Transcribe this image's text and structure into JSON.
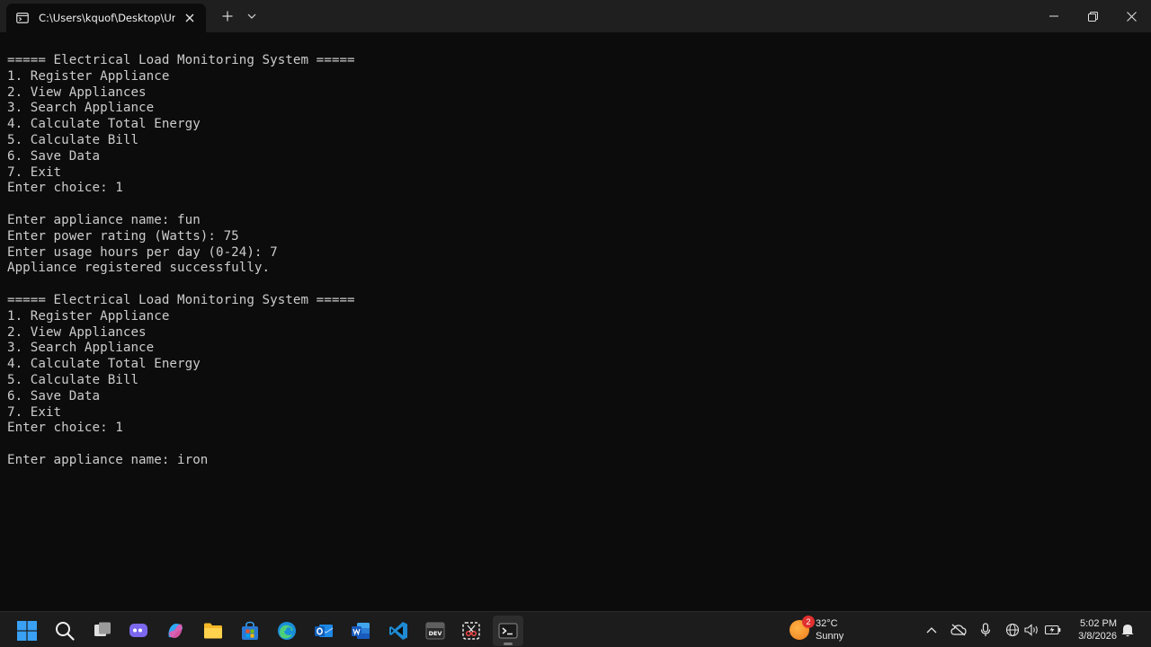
{
  "window": {
    "tab_title": "C:\\Users\\kquof\\Desktop\\Untit",
    "icons": {
      "tab": "terminal-tab-icon",
      "close_tab": "close-icon",
      "new_tab": "plus-icon",
      "dropdown": "chevron-down-icon",
      "minimize": "minimize-icon",
      "maximize": "restore-icon",
      "close": "close-icon"
    }
  },
  "terminal": {
    "lines": [
      "===== Electrical Load Monitoring System =====",
      "1. Register Appliance",
      "2. View Appliances",
      "3. Search Appliance",
      "4. Calculate Total Energy",
      "5. Calculate Bill",
      "6. Save Data",
      "7. Exit",
      "Enter choice: 1",
      "",
      "Enter appliance name: fun",
      "Enter power rating (Watts): 75",
      "Enter usage hours per day (0-24): 7",
      "Appliance registered successfully.",
      "",
      "===== Electrical Load Monitoring System =====",
      "1. Register Appliance",
      "2. View Appliances",
      "3. Search Appliance",
      "4. Calculate Total Energy",
      "5. Calculate Bill",
      "6. Save Data",
      "7. Exit",
      "Enter choice: 1",
      "",
      "Enter appliance name: iron"
    ]
  },
  "taskbar": {
    "apps": [
      "windows-start-icon",
      "search-icon",
      "task-view-icon",
      "teams-chat-icon",
      "copilot-icon",
      "file-explorer-icon",
      "microsoft-store-icon",
      "edge-icon",
      "outlook-icon",
      "word-icon",
      "vscode-icon",
      "dev-tools-icon",
      "snipping-tool-icon",
      "terminal-icon"
    ],
    "weather": {
      "badge": "2",
      "temperature": "32°C",
      "condition": "Sunny"
    },
    "clock": {
      "time": "5:02 PM",
      "date": "3/8/2026"
    }
  }
}
